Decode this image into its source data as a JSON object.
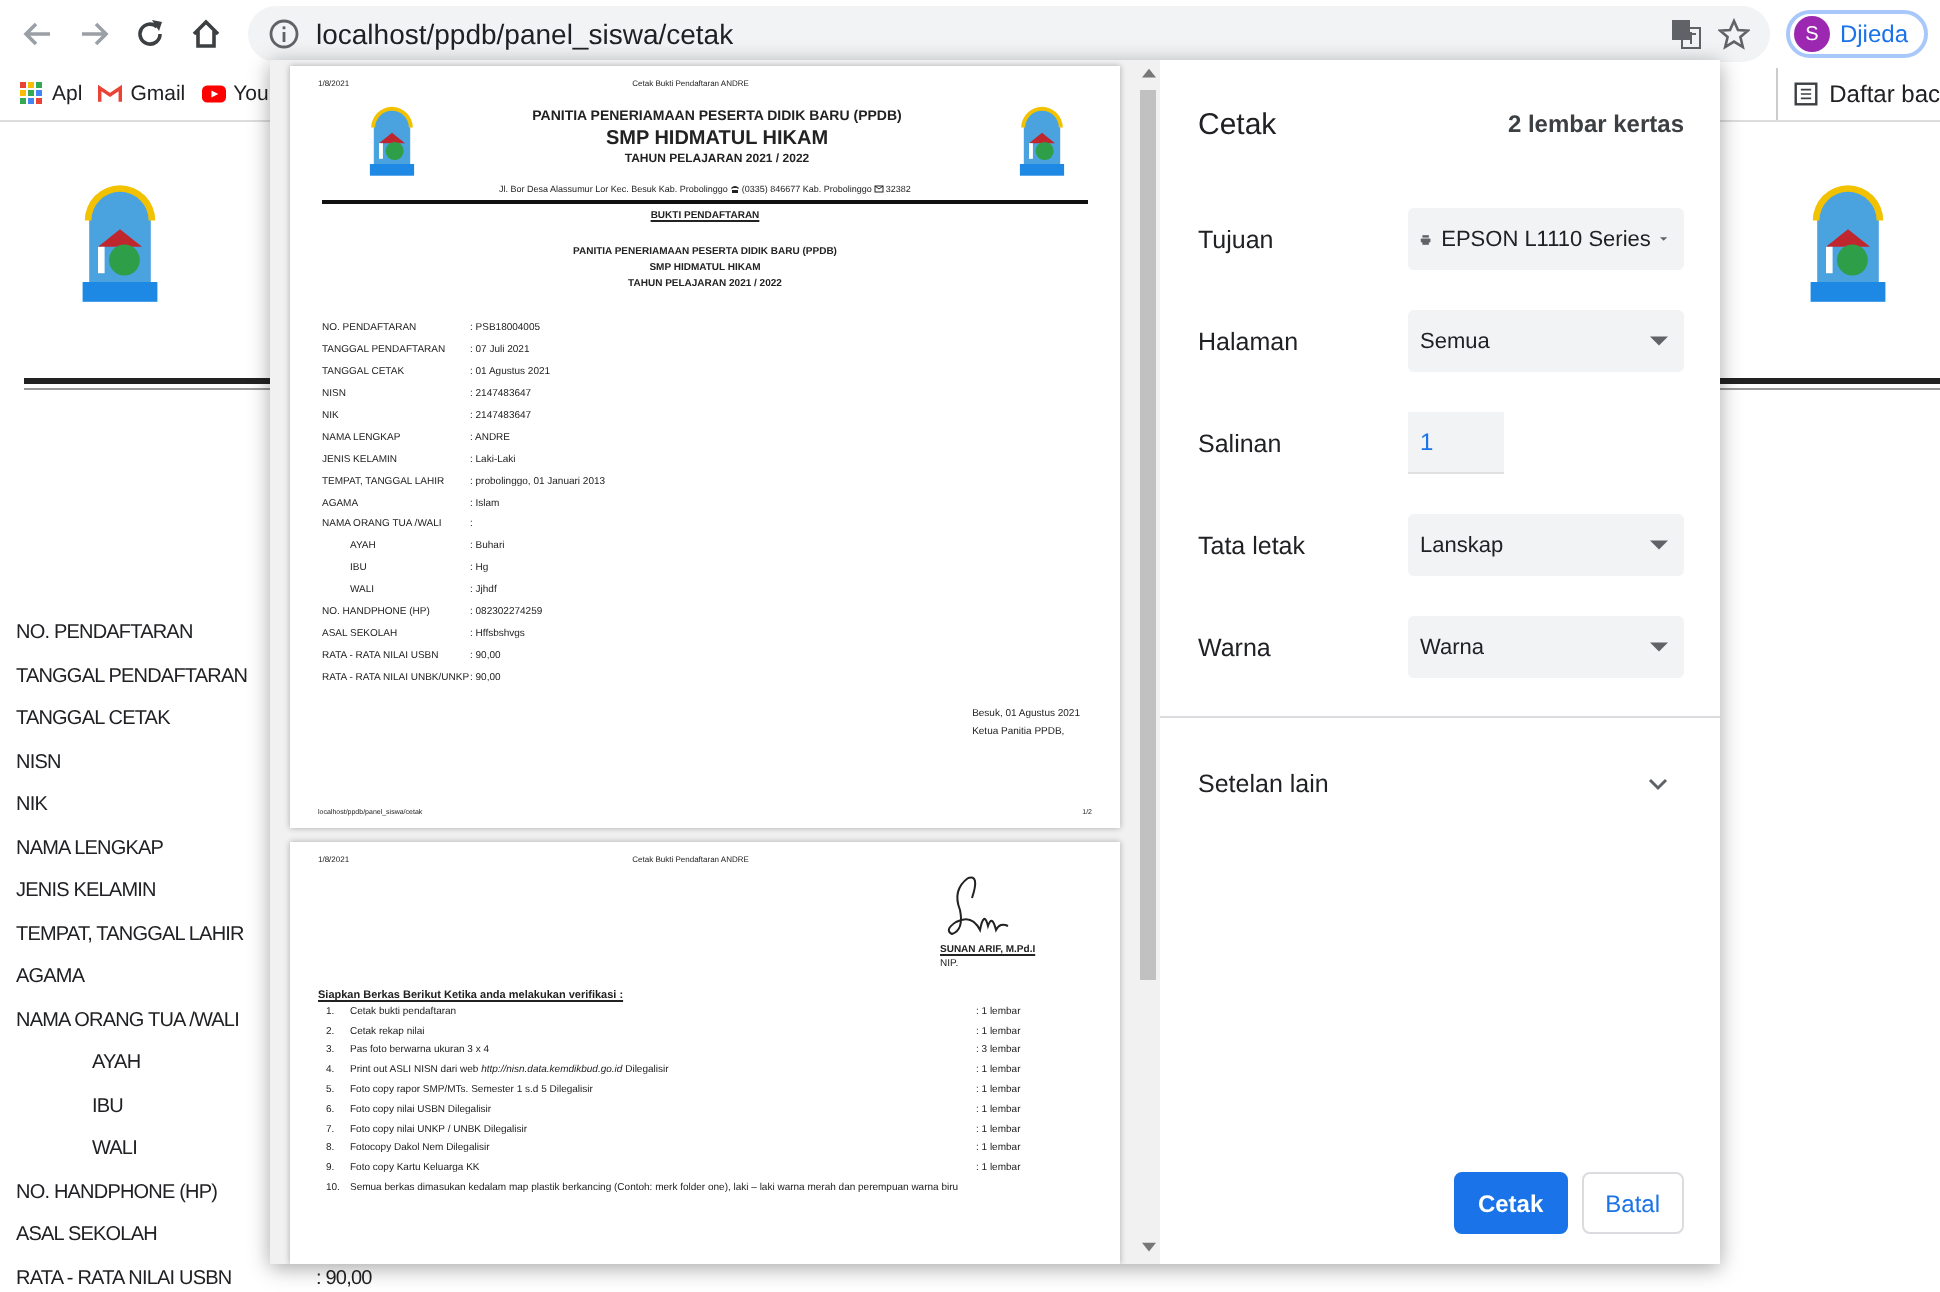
{
  "browser": {
    "url": "localhost/ppdb/panel_siswa/cetak",
    "profile_initial": "S",
    "profile_name": "Djieda"
  },
  "bookmarks": [
    {
      "label": "Apl",
      "kind": "apps"
    },
    {
      "label": "Gmail",
      "kind": "gmail"
    },
    {
      "label": "You",
      "kind": "youtube"
    }
  ],
  "reading_list": "Daftar bac",
  "page": {
    "fields": [
      {
        "label": "NO. PENDAFTARAN"
      },
      {
        "label": "TANGGAL PENDAFTARAN"
      },
      {
        "label": "TANGGAL CETAK"
      },
      {
        "label": "NISN"
      },
      {
        "label": "NIK"
      },
      {
        "label": "NAMA LENGKAP"
      },
      {
        "label": "JENIS KELAMIN"
      },
      {
        "label": "TEMPAT, TANGGAL LAHIR"
      },
      {
        "label": "AGAMA"
      },
      {
        "label": "NAMA ORANG TUA /WALI",
        "children": [
          {
            "label": "AYAH"
          },
          {
            "label": "IBU"
          },
          {
            "label": "WALI"
          }
        ]
      },
      {
        "label": "NO. HANDPHONE (HP)"
      },
      {
        "label": "ASAL SEKOLAH"
      },
      {
        "label": "RATA - RATA NILAI USBN",
        "value": ": 90,00"
      }
    ]
  },
  "print_preview": {
    "pages": [
      {
        "kind": "receipt",
        "header_date": "1/8/2021",
        "header_title": "Cetak Bukti Pendaftaran ANDRE",
        "letterhead": {
          "committee": "PANITIA PENERIAMAAN PESERTA DIDIK BARU (PPDB)",
          "school": "SMP HIDMATUL HIKAM",
          "year": "TAHUN PELAJARAN 2021 / 2022",
          "address": "Jl. Bor Desa Alassumur Lor Kec. Besuk Kab. Probolinggo",
          "phone": "(0335) 846677 Kab. Probolinggo",
          "postcode": "32382"
        },
        "section_title": "BUKTI PENDAFTARAN",
        "subheading": [
          "PANITIA PENERIAMAAN PESERTA DIDIK BARU (PPDB)",
          "SMP HIDMATUL HIKAM",
          "TAHUN PELAJARAN 2021 / 2022"
        ],
        "fields": [
          {
            "label": "NO. PENDAFTARAN",
            "value": ": PSB18004005"
          },
          {
            "label": "TANGGAL PENDAFTARAN",
            "value": ": 07 Juli 2021"
          },
          {
            "label": "TANGGAL CETAK",
            "value": ": 01 Agustus 2021"
          },
          {
            "label": "NISN",
            "value": ": 2147483647"
          },
          {
            "label": "NIK",
            "value": ": 2147483647"
          },
          {
            "label": "NAMA LENGKAP",
            "value": ": ANDRE"
          },
          {
            "label": "JENIS KELAMIN",
            "value": ": Laki-Laki"
          },
          {
            "label": "TEMPAT, TANGGAL LAHIR",
            "value": ": probolinggo, 01 Januari 2013"
          },
          {
            "label": "AGAMA",
            "value": ": Islam"
          },
          {
            "label": "NAMA ORANG TUA /WALI",
            "value": ":",
            "children": [
              {
                "label": "AYAH",
                "value": ": Buhari"
              },
              {
                "label": "IBU",
                "value": ": Hg"
              },
              {
                "label": "WALI",
                "value": ": Jjhdf"
              }
            ]
          },
          {
            "label": "NO. HANDPHONE (HP)",
            "value": ": 082302274259"
          },
          {
            "label": "ASAL SEKOLAH",
            "value": ": Hffsbshvgs"
          },
          {
            "label": "RATA - RATA NILAI USBN",
            "value": ": 90,00"
          },
          {
            "label": "RATA - RATA NILAI UNBK/UNKP",
            "value": ": 90,00"
          }
        ],
        "place_date": "Besuk, 01 Agustus 2021",
        "signer_title": "Ketua Panitia PPDB,",
        "footer_url": "localhost/ppdb/panel_siswa/cetak",
        "footer_page": "1/2"
      },
      {
        "kind": "checklist",
        "header_date": "1/8/2021",
        "header_title": "Cetak Bukti Pendaftaran ANDRE",
        "signer_name": "SUNAN ARIF, M.Pd.I",
        "signer_id": "NIP.",
        "checklist_title": "Siapkan Berkas Berikut Ketika anda melakukan verifikasi :",
        "items": [
          {
            "number": "1.",
            "text": "Cetak bukti pendaftaran",
            "qty": ": 1 lembar"
          },
          {
            "number": "2.",
            "text": "Cetak rekap nilai",
            "qty": ": 1 lembar"
          },
          {
            "number": "3.",
            "text": "Pas foto berwarna ukuran 3 x 4",
            "qty": ": 3 lembar"
          },
          {
            "number": "4.",
            "text": "Print out ASLI NISN dari web *http://nisn.data.kemdikbud.go.id* Dilegalisir",
            "qty": ": 1 lembar"
          },
          {
            "number": "5.",
            "text": "Foto copy rapor SMP/MTs. Semester 1 s.d 5 Dilegalisir",
            "qty": ": 1 lembar"
          },
          {
            "number": "6.",
            "text": "Foto copy nilai USBN Dilegalisir",
            "qty": ": 1 lembar"
          },
          {
            "number": "7.",
            "text": "Foto copy nilai UNKP / UNBK Dilegalisir",
            "qty": ": 1 lembar"
          },
          {
            "number": "8.",
            "text": "Fotocopy Dakol Nem Dilegalisir",
            "qty": ": 1 lembar"
          },
          {
            "number": "9.",
            "text": "Foto copy Kartu Keluarga KK",
            "qty": ": 1 lembar"
          },
          {
            "number": "10.",
            "text": "Semua berkas dimasukan kedalam map plastik berkancing (Contoh: merk folder one), laki – laki warna merah dan perempuan warna biru"
          }
        ]
      }
    ]
  },
  "settings": {
    "title": "Cetak",
    "sheets": "2 lembar kertas",
    "rows": [
      {
        "label": "Tujuan",
        "kind": "printer",
        "value": "EPSON L1110 Series"
      },
      {
        "label": "Halaman",
        "kind": "select",
        "value": "Semua"
      },
      {
        "label": "Salinan",
        "kind": "number",
        "value": "1"
      },
      {
        "label": "Tata letak",
        "kind": "select",
        "value": "Lanskap"
      },
      {
        "label": "Warna",
        "kind": "select",
        "value": "Warna"
      }
    ],
    "more": {
      "label": "Setelan lain",
      "expanded": false
    },
    "buttons": [
      {
        "label": "Cetak",
        "kind": "primary"
      },
      {
        "label": "Batal",
        "kind": "secondary"
      }
    ]
  }
}
